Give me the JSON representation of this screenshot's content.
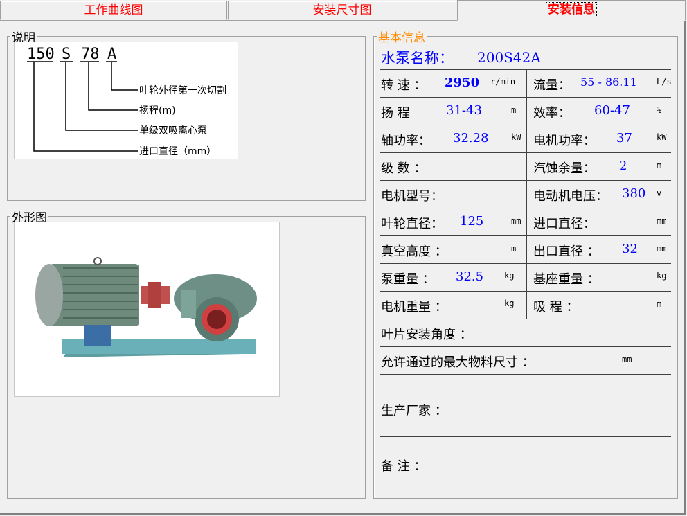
{
  "tabs": [
    "工作曲线图",
    "安装尺寸图",
    "安装信息"
  ],
  "sections": {
    "description": "说明",
    "shape": "外形图",
    "basic": "基本信息"
  },
  "model_diagram": {
    "parts": [
      "150",
      "S",
      "78",
      "A"
    ],
    "notes": [
      "叶轮外径第一次切割",
      "扬程(m)",
      "单级双吸离心泵",
      "进口直径（mm）"
    ]
  },
  "basic": {
    "pump_name_label": "水泵名称：",
    "pump_name": "200S42A",
    "speed_label": "转 速 ：",
    "speed": "2950",
    "speed_unit": "r/min",
    "flow_label": "流量：",
    "flow": "55 - 86.11",
    "flow_unit": "L/s",
    "head_label": "扬 程",
    "head": "31-43",
    "head_unit": "m",
    "eff_label": "效率：",
    "eff": "60-47",
    "eff_unit": "%",
    "shaft_power_label": "轴功率：",
    "shaft_power": "32.28",
    "shaft_power_unit": "kW",
    "motor_power_label": "电机功率：",
    "motor_power": "37",
    "motor_power_unit": "kW",
    "stages_label": "级 数 ：",
    "npsh_label": "汽蚀余量：",
    "npsh": "2",
    "npsh_unit": "m",
    "motor_model_label": "电机型号：",
    "voltage_label": "电动机电压：",
    "voltage": "380",
    "voltage_unit": "v",
    "impeller_label": "叶轮直径：",
    "impeller": "125",
    "impeller_unit": "mm",
    "inlet_label": "进口直径：",
    "inlet_unit": "mm",
    "vacuum_label": "真空高度 ：",
    "vacuum_unit": "m",
    "outlet_label": "出口直径 ：",
    "outlet": "32",
    "outlet_unit": "mm",
    "pump_weight_label": "泵重量 ：",
    "pump_weight": "32.5",
    "pump_weight_unit": "kg",
    "base_weight_label": "基座重量 ：",
    "base_weight_unit": "kg",
    "motor_weight_label": "电机重量 ：",
    "motor_weight_unit": "kg",
    "suction_label": "吸 程 ：",
    "suction_unit": "m",
    "blade_angle_label": "叶片安装角度 ：",
    "max_particle_label": "允许通过的最大物料尺寸 ：",
    "max_particle_unit": "mm",
    "manufacturer_label": "生产厂家 ：",
    "remarks_label": "备 注 ："
  }
}
